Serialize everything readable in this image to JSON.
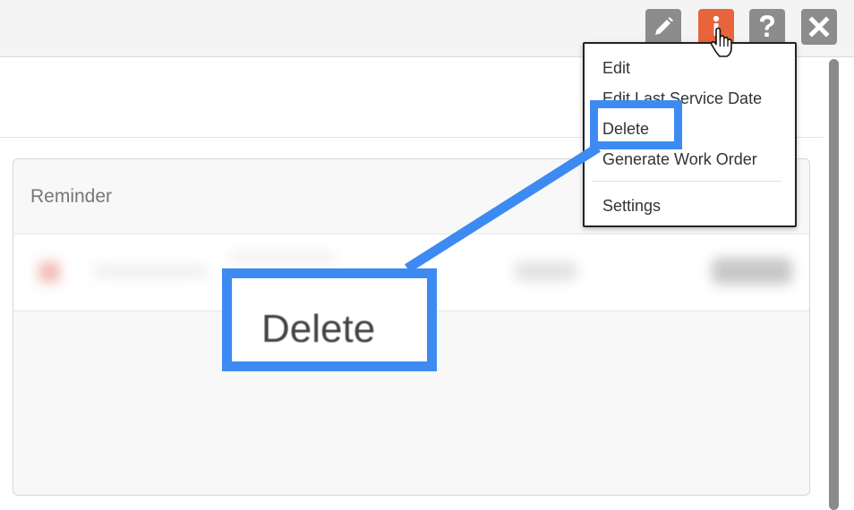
{
  "toolbar": {
    "buttons": [
      {
        "name": "edit",
        "icon": "pencil-icon",
        "color": "#8c8c8c"
      },
      {
        "name": "actions",
        "icon": "info-icon",
        "color": "#e8643a"
      },
      {
        "name": "help",
        "icon": "question-icon",
        "color": "#8c8c8c"
      },
      {
        "name": "close",
        "icon": "close-icon",
        "color": "#8c8c8c"
      }
    ]
  },
  "dropdown_menu": {
    "items": [
      {
        "label": "Edit"
      },
      {
        "label": "Edit Last Service Date"
      },
      {
        "label": "Delete"
      },
      {
        "label": "Generate Work Order"
      },
      {
        "label": "Settings"
      }
    ]
  },
  "card": {
    "title": "Reminder"
  },
  "callout": {
    "label": "Delete",
    "color": "#3d8bf2"
  }
}
